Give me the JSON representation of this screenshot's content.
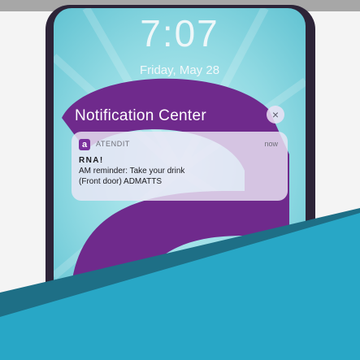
{
  "lock_screen": {
    "time": "7:07",
    "date": "Friday, May 28"
  },
  "notification_center": {
    "title": "Notification Center",
    "close_glyph": "×",
    "notification": {
      "app_icon_glyph": "a",
      "app_name": "ATENDIT",
      "time": "now",
      "title": "RNA!",
      "lines": [
        "AM reminder: Take your drink",
        "(Front door) ADMATTS"
      ]
    }
  },
  "colors": {
    "accent_purple": "#6f2a8c",
    "wallpaper": "#88d7e0",
    "banner_teal": "#28a7c6"
  }
}
